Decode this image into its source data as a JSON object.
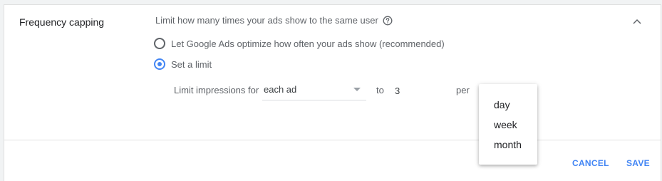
{
  "section": {
    "title": "Frequency capping",
    "description": "Limit how many times your ads show to the same user"
  },
  "options": {
    "optimize_label": "Let Google Ads optimize how often your ads show (recommended)",
    "set_limit_label": "Set a limit",
    "selected": "set_limit"
  },
  "limit": {
    "label": "Limit impressions for",
    "scope_value": "each ad",
    "to_label": "to",
    "count_value": "3",
    "per_label": "per"
  },
  "dropdown": {
    "items": [
      "day",
      "week",
      "month"
    ]
  },
  "actions": {
    "cancel_label": "CANCEL",
    "save_label": "SAVE"
  },
  "colors": {
    "accent": "#4285f4",
    "text_secondary": "#5f6368"
  },
  "icons": {
    "help": "help-circle-icon",
    "collapse": "chevron-up-icon",
    "select_arrow": "arrow-drop-down-icon"
  }
}
